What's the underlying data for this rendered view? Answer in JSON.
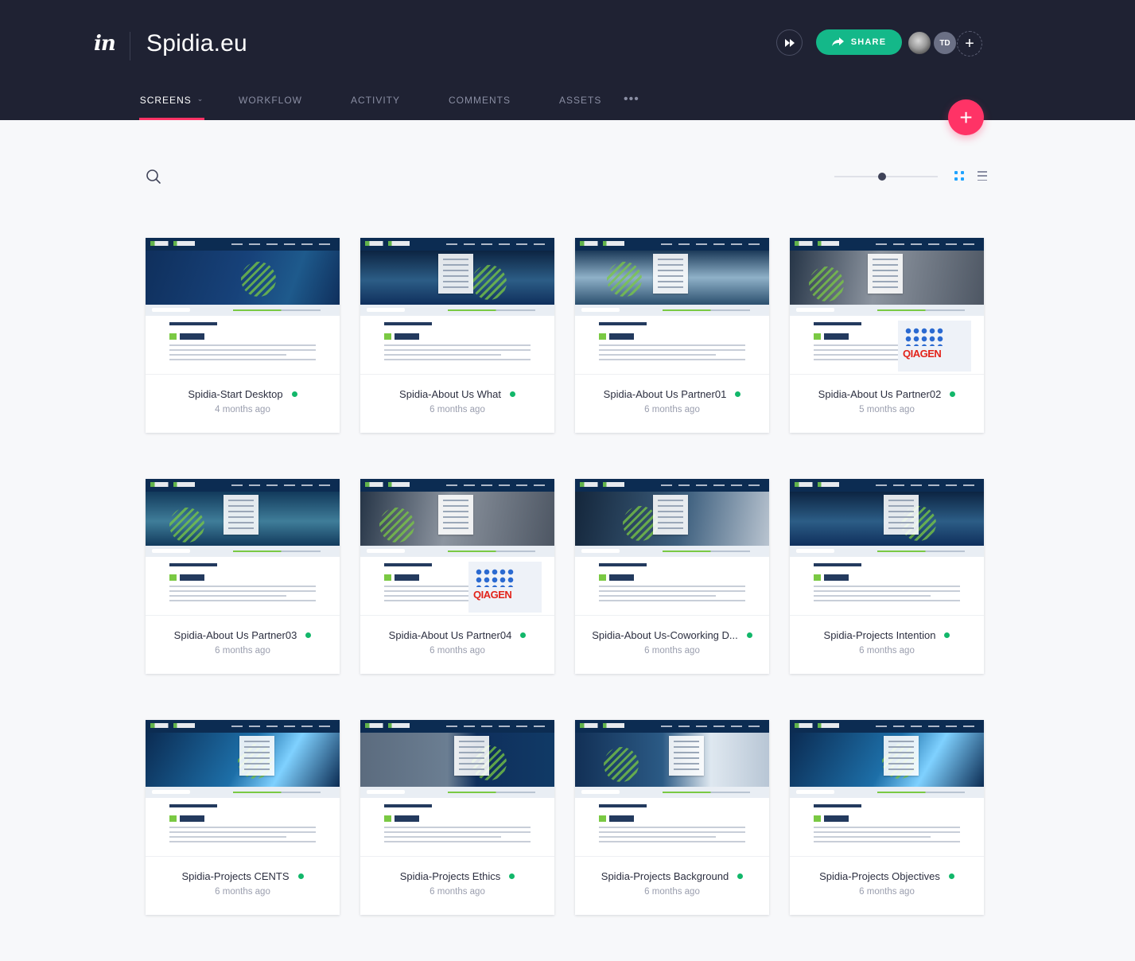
{
  "app": {
    "logo_text": "in",
    "project_title": "Spidia.eu"
  },
  "header": {
    "share_label": "SHARE",
    "collaborator_initials": "TD",
    "add_collaborator_symbol": "+",
    "more_symbol": "•••",
    "new_screen_symbol": "+"
  },
  "tabs": [
    {
      "label": "SCREENS",
      "active": true
    },
    {
      "label": "WORKFLOW",
      "active": false
    },
    {
      "label": "ACTIVITY",
      "active": false
    },
    {
      "label": "COMMENTS",
      "active": false
    },
    {
      "label": "ASSETS",
      "active": false
    }
  ],
  "toolbar": {
    "search_icon": "search-icon",
    "zoom_level": 0.46,
    "view_mode": "grid"
  },
  "colors": {
    "header_bg": "#1f2233",
    "accent_pink": "#ff3366",
    "share_green": "#14b889",
    "status_green": "#12b76a",
    "grid_view_active": "#1fa3ff"
  },
  "screens": [
    {
      "title": "Spidia-Start Desktop",
      "time": "4 months ago"
    },
    {
      "title": "Spidia-About Us What",
      "time": "6 months ago"
    },
    {
      "title": "Spidia-About Us Partner01",
      "time": "6 months ago"
    },
    {
      "title": "Spidia-About Us Partner02",
      "time": "5 months ago"
    },
    {
      "title": "Spidia-About Us Partner03",
      "time": "6 months ago"
    },
    {
      "title": "Spidia-About Us Partner04",
      "time": "6 months ago"
    },
    {
      "title": "Spidia-About Us-Coworking D...",
      "time": "6 months ago"
    },
    {
      "title": "Spidia-Projects Intention",
      "time": "6 months ago"
    },
    {
      "title": "Spidia-Projects CENTS",
      "time": "6 months ago"
    },
    {
      "title": "Spidia-Projects Ethics",
      "time": "6 months ago"
    },
    {
      "title": "Spidia-Projects Background",
      "time": "6 months ago"
    },
    {
      "title": "Spidia-Projects Objectives",
      "time": "6 months ago"
    }
  ]
}
